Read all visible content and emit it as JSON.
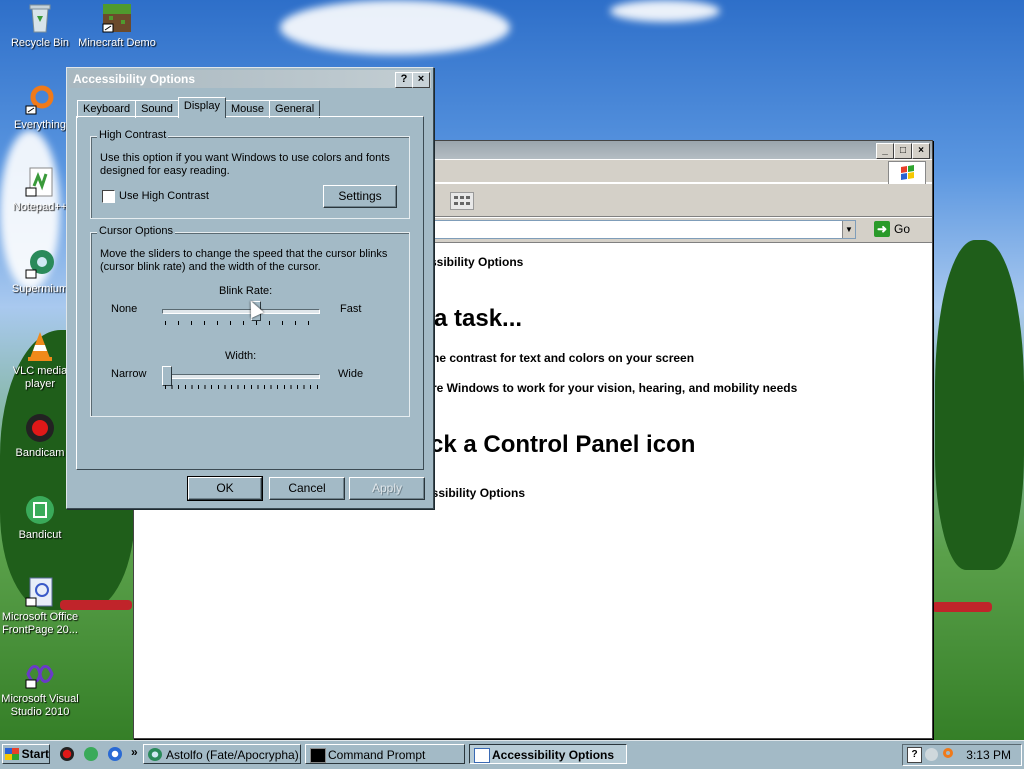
{
  "desktop": {
    "icons": [
      {
        "label": "Recycle Bin"
      },
      {
        "label": "Minecraft Demo"
      },
      {
        "label": "Everything"
      },
      {
        "label": "Notepad++"
      },
      {
        "label": "Supermium"
      },
      {
        "label": "VLC media player"
      },
      {
        "label": "Bandicam"
      },
      {
        "label": "Bandicut"
      },
      {
        "label": "Microsoft Office FrontPage 20..."
      },
      {
        "label": "Microsoft Visual Studio 2010"
      }
    ]
  },
  "explorer": {
    "address_go": "Go",
    "content": {
      "breadcrumb": "ssibility Options",
      "heading_task": "a task...",
      "task1": "he contrast for text and colors on your screen",
      "task2": "re Windows to work for your vision, hearing, and mobility needs",
      "heading_icon": "ck a Control Panel icon",
      "icon1": "essibility Options"
    }
  },
  "dialog": {
    "title": "Accessibility Options",
    "help_btn": "?",
    "close_btn": "×",
    "tabs": [
      {
        "label": "Keyboard",
        "active": false
      },
      {
        "label": "Sound",
        "active": false
      },
      {
        "label": "Display",
        "active": true
      },
      {
        "label": "Mouse",
        "active": false
      },
      {
        "label": "General",
        "active": false
      }
    ],
    "high_contrast": {
      "group_label": "High Contrast",
      "description": "Use this option if you want Windows to use colors and fonts designed for easy reading.",
      "checkbox_label": "Use High Contrast",
      "checked": false,
      "settings_btn": "Settings"
    },
    "cursor_options": {
      "group_label": "Cursor Options",
      "description": "Move the sliders to change the speed that the cursor blinks (cursor blink rate) and the width of the cursor.",
      "blink_label": "Blink Rate:",
      "blink_min": "None",
      "blink_max": "Fast",
      "blink_value": 0.6,
      "width_label": "Width:",
      "width_min": "Narrow",
      "width_max": "Wide",
      "width_value": 0.0
    },
    "buttons": {
      "ok": "OK",
      "cancel": "Cancel",
      "apply": "Apply"
    }
  },
  "taskbar": {
    "start": "Start",
    "overflow": "»",
    "tasks": [
      {
        "label": "Astolfo (Fate/Apocrypha)...",
        "active": false
      },
      {
        "label": "Command Prompt",
        "active": false
      },
      {
        "label": "Accessibility Options",
        "active": true
      }
    ],
    "clock": "3:13 PM"
  }
}
